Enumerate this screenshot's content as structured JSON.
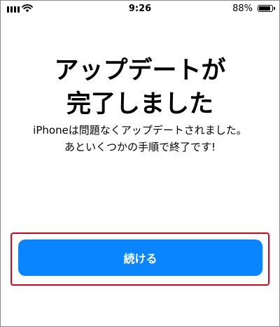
{
  "colors": {
    "accent": "#0a84ff",
    "highlight": "#e0001a"
  },
  "status_bar": {
    "time": "9:26",
    "battery_percent": "88%",
    "battery_level": 0.88,
    "icons": [
      "cellular-signal-icon",
      "wifi-icon",
      "battery-icon"
    ]
  },
  "title_lines": [
    "アップデートが",
    "完了しました"
  ],
  "message_lines": [
    "iPhoneは問題なくアップデートされました。",
    "あといくつかの手順で終了です!"
  ],
  "continue_label": "続ける"
}
